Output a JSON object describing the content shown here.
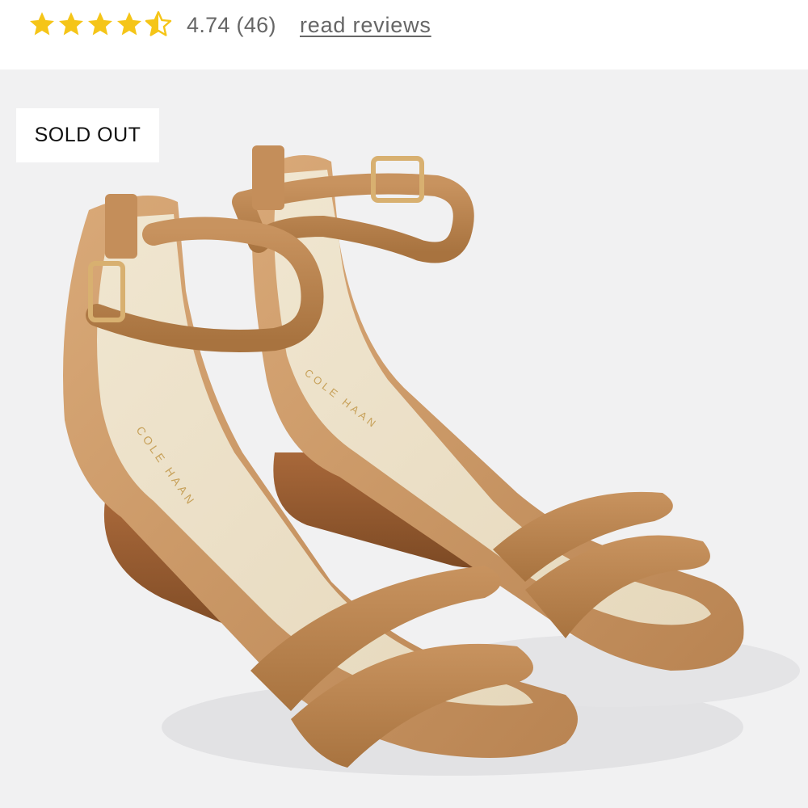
{
  "rating": {
    "value": 4.74,
    "max_stars": 5,
    "display": "4.74 (46)",
    "reviews_link": "read reviews",
    "star_color": "#f5c518",
    "star_icon": "star-icon"
  },
  "product_image": {
    "badge": "SOLD OUT",
    "insole_brand": "COLE HAAN",
    "background": "#f1f1f2"
  }
}
